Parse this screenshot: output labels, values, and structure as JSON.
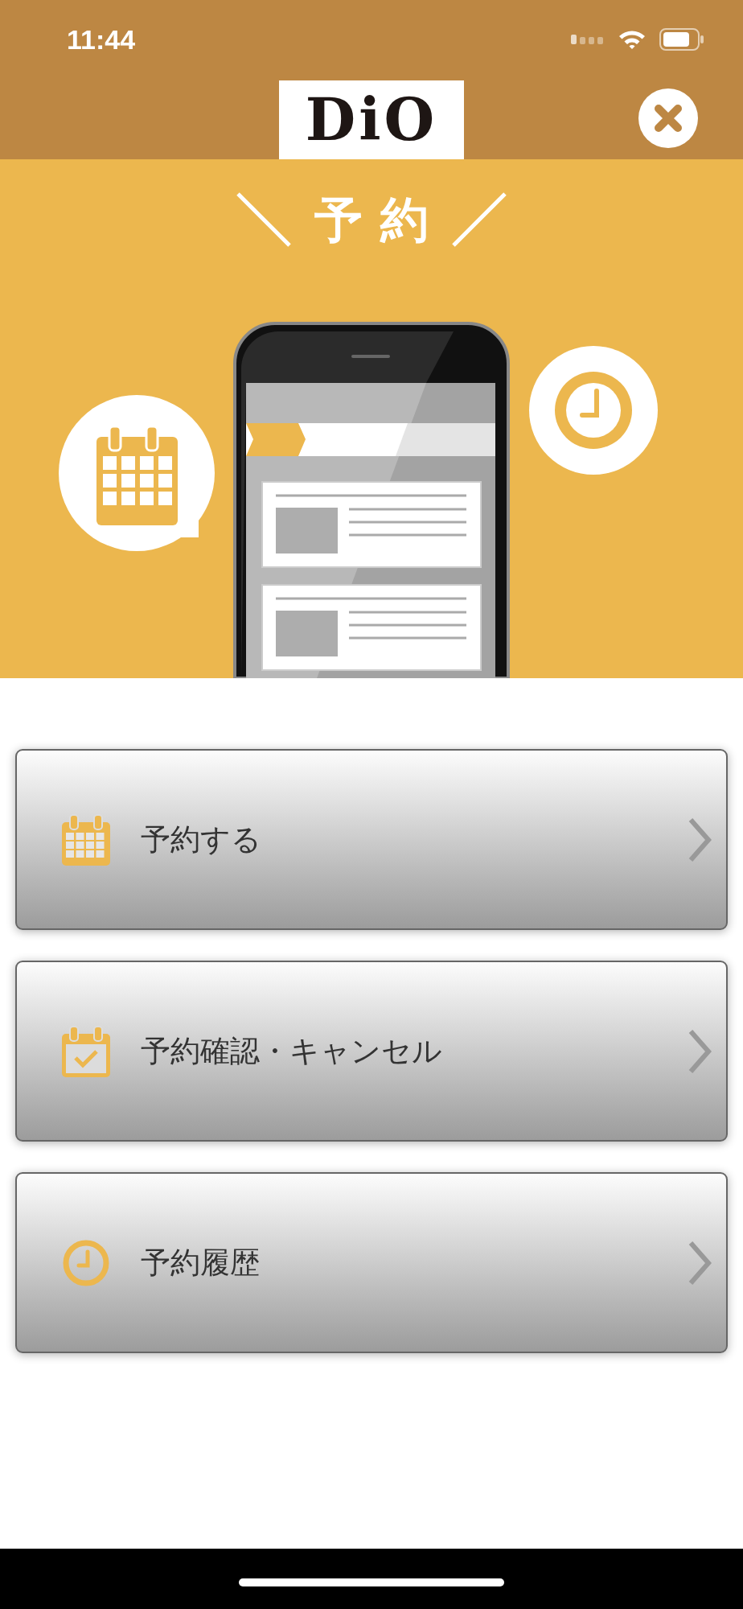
{
  "status_bar": {
    "time": "11:44"
  },
  "header": {
    "logo": "DiO"
  },
  "banner": {
    "title": "予約"
  },
  "menu": [
    {
      "label": "予約する",
      "kind": "calendar"
    },
    {
      "label": "予約確認・キャンセル",
      "kind": "calendar-check"
    },
    {
      "label": "予約履歴",
      "kind": "clock"
    }
  ]
}
